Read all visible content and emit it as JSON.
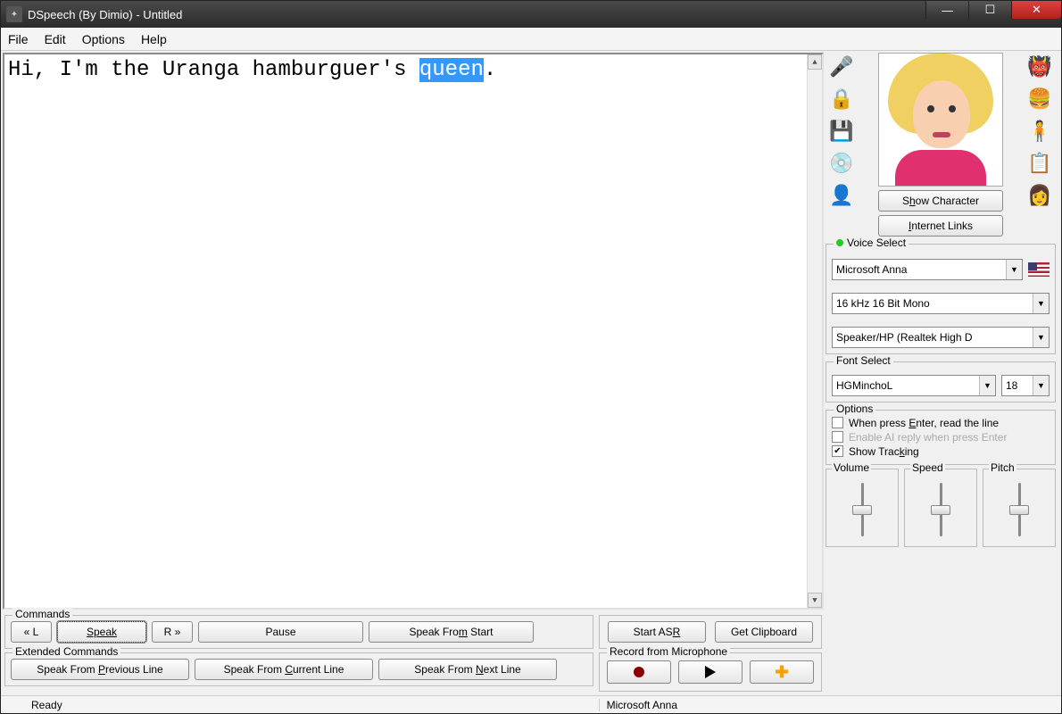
{
  "titlebar": {
    "title": "DSpeech (By Dimio) - Untitled"
  },
  "menu": {
    "file": "File",
    "edit": "Edit",
    "options": "Options",
    "help": "Help"
  },
  "text": {
    "before_hl": "Hi, I'm the Uranga hamburguer's ",
    "hl": "queen",
    "after_hl": "."
  },
  "side_buttons": {
    "show_character": "Show Character",
    "internet_links": "Internet Links"
  },
  "voice_select": {
    "legend": "Voice Select",
    "voice": "Microsoft Anna",
    "format": "16 kHz 16 Bit Mono",
    "device": "Speaker/HP (Realtek High D"
  },
  "font_select": {
    "legend": "Font Select",
    "font": "HGMinchoL",
    "size": "18"
  },
  "options": {
    "legend": "Options",
    "opt1": "When press Enter, read the line",
    "opt2": "Enable AI reply when press Enter",
    "opt3": "Show Tracking"
  },
  "sliders": {
    "volume": "Volume",
    "speed": "Speed",
    "pitch": "Pitch"
  },
  "commands": {
    "legend": "Commands",
    "ll": "« L",
    "speak": "Speak",
    "rr": "R »",
    "pause": "Pause",
    "from_start": "Speak From Start",
    "start_asr": "Start ASR",
    "get_clip": "Get Clipboard"
  },
  "ext_commands": {
    "legend": "Extended Commands",
    "prev": "Speak From Previous Line",
    "curr": "Speak From Current Line",
    "next": "Speak From Next Line"
  },
  "record": {
    "legend": "Record from Microphone"
  },
  "status": {
    "ready": "Ready",
    "voice": "Microsoft Anna"
  }
}
